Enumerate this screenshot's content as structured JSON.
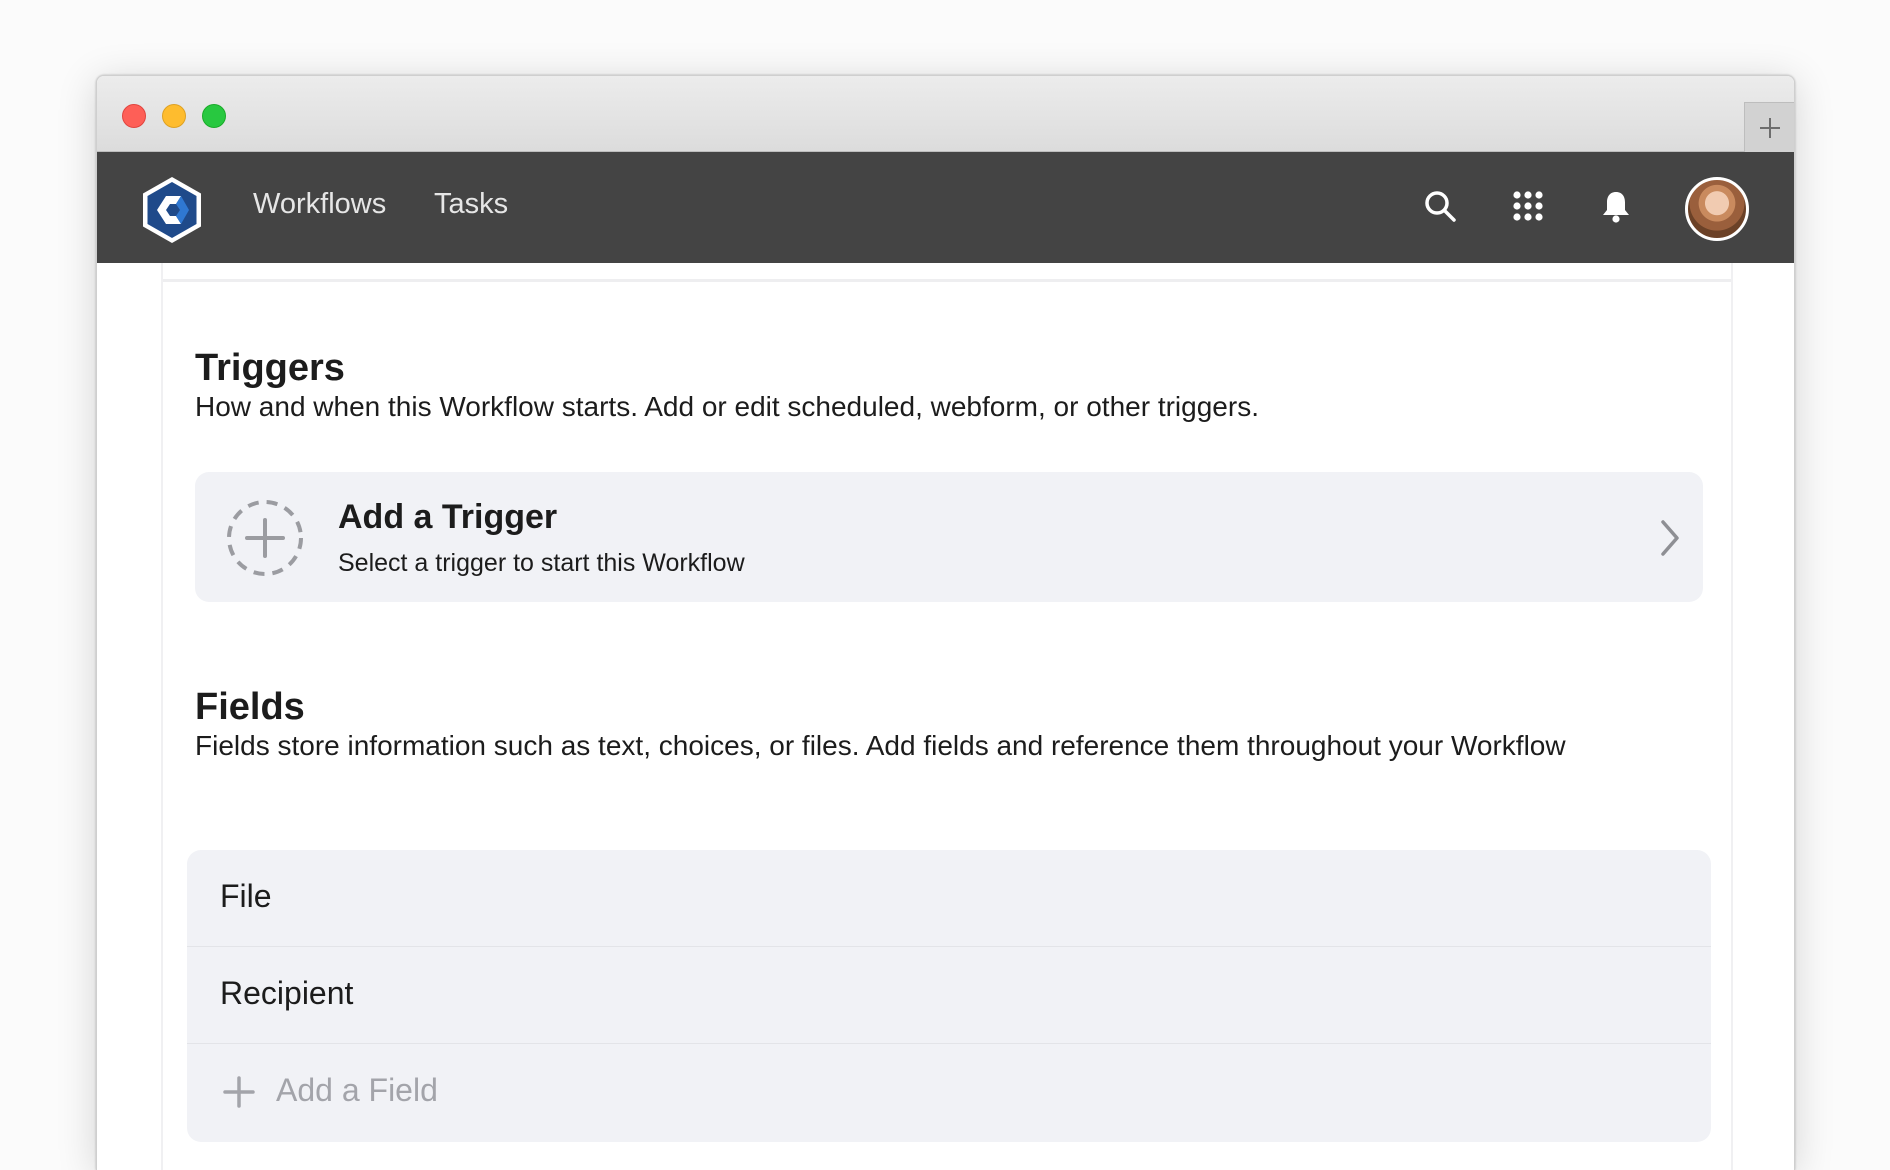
{
  "nav": {
    "links": [
      "Workflows",
      "Tasks"
    ]
  },
  "triggers": {
    "title": "Triggers",
    "description": "How and when this Workflow starts. Add or edit scheduled, webform, or other triggers.",
    "add_card": {
      "title": "Add a Trigger",
      "subtitle": "Select a trigger to start this Workflow"
    }
  },
  "fields": {
    "title": "Fields",
    "description": "Fields store information such as text, choices, or files. Add fields and reference them throughout your Workflow",
    "items": [
      "File",
      "Recipient"
    ],
    "add_label": "Add a Field"
  },
  "icons": {
    "logo": "workflow-logo-icon",
    "search": "search-icon",
    "apps": "apps-grid-icon",
    "notifications": "bell-icon",
    "new_tab": "plus-icon"
  },
  "colors": {
    "header_bg": "#444444",
    "brand_blue": "#1f4a8a",
    "card_bg": "#f1f2f6",
    "placeholder_text": "#a3a4aa"
  }
}
